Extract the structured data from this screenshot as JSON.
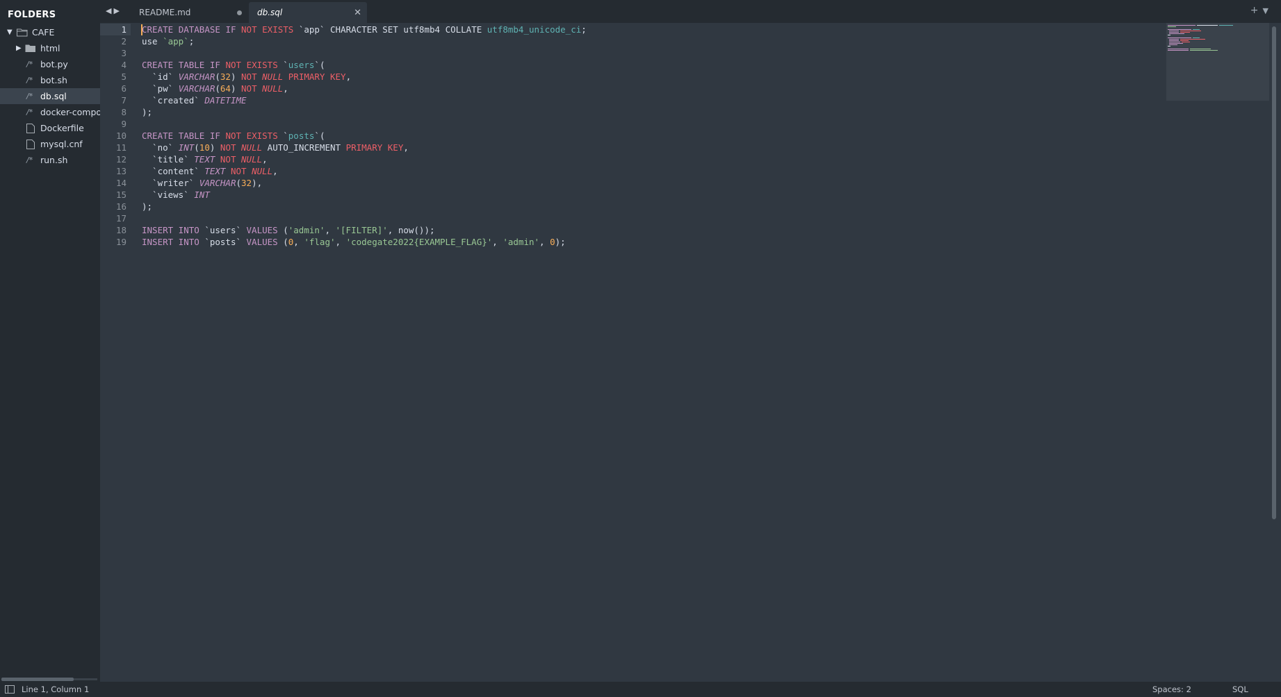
{
  "sidebar": {
    "header": "FOLDERS",
    "root": {
      "label": "CAFE",
      "expanded": true
    },
    "items": [
      {
        "label": "html",
        "kind": "folder",
        "expanded": false
      },
      {
        "label": "bot.py",
        "kind": "code-file"
      },
      {
        "label": "bot.sh",
        "kind": "code-file"
      },
      {
        "label": "db.sql",
        "kind": "code-file",
        "selected": true
      },
      {
        "label": "docker-compo",
        "kind": "code-file"
      },
      {
        "label": "Dockerfile",
        "kind": "plain-file"
      },
      {
        "label": "mysql.cnf",
        "kind": "plain-file"
      },
      {
        "label": "run.sh",
        "kind": "code-file"
      }
    ]
  },
  "tabs": [
    {
      "label": "README.md",
      "active": false,
      "dirty": true
    },
    {
      "label": "db.sql",
      "active": true,
      "dirty": false
    }
  ],
  "editor": {
    "current_line": 1,
    "line_numbers": [
      "1",
      "2",
      "3",
      "4",
      "5",
      "6",
      "7",
      "8",
      "9",
      "10",
      "11",
      "12",
      "13",
      "14",
      "15",
      "16",
      "17",
      "18",
      "19"
    ]
  },
  "statusbar": {
    "position": "Line 1, Column 1",
    "indentation": "Spaces: 2",
    "syntax": "SQL"
  },
  "icons": {
    "nav": "nav-arrows-icon",
    "folder": "folder-icon",
    "file": "file-icon",
    "code_file": "code-file-icon",
    "new_tab": "plus-icon",
    "tab_menu": "chevron-down-icon",
    "panel_toggle": "panel-icon"
  },
  "colors": {
    "background": "#303841",
    "sidebar": "#252b31",
    "keyword": "#c695c6",
    "negation": "#ec5f67",
    "string": "#99c794",
    "number": "#f9ae58",
    "table_name": "#5fb3b3"
  }
}
